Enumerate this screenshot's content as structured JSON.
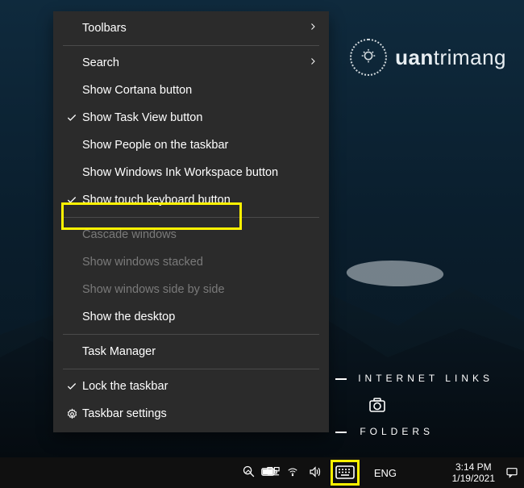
{
  "watermark": {
    "uan": "uan",
    "trimang": "trimang"
  },
  "menu": {
    "toolbars": "Toolbars",
    "search": "Search",
    "cortana": "Show Cortana button",
    "taskview": "Show Task View button",
    "people": "Show People on the taskbar",
    "ink": "Show Windows Ink Workspace button",
    "touchkbd": "Show touch keyboard button",
    "cascade": "Cascade windows",
    "stacked": "Show windows stacked",
    "sidebyside": "Show windows side by side",
    "desktop": "Show the desktop",
    "taskmgr": "Task Manager",
    "lock": "Lock the taskbar",
    "settings": "Taskbar settings"
  },
  "desktop_labels": {
    "internet": "INTERNET LINKS",
    "folders": "FOLDERS"
  },
  "taskbar": {
    "lang": "ENG",
    "time": "3:14 PM",
    "date": "1/19/2021"
  }
}
